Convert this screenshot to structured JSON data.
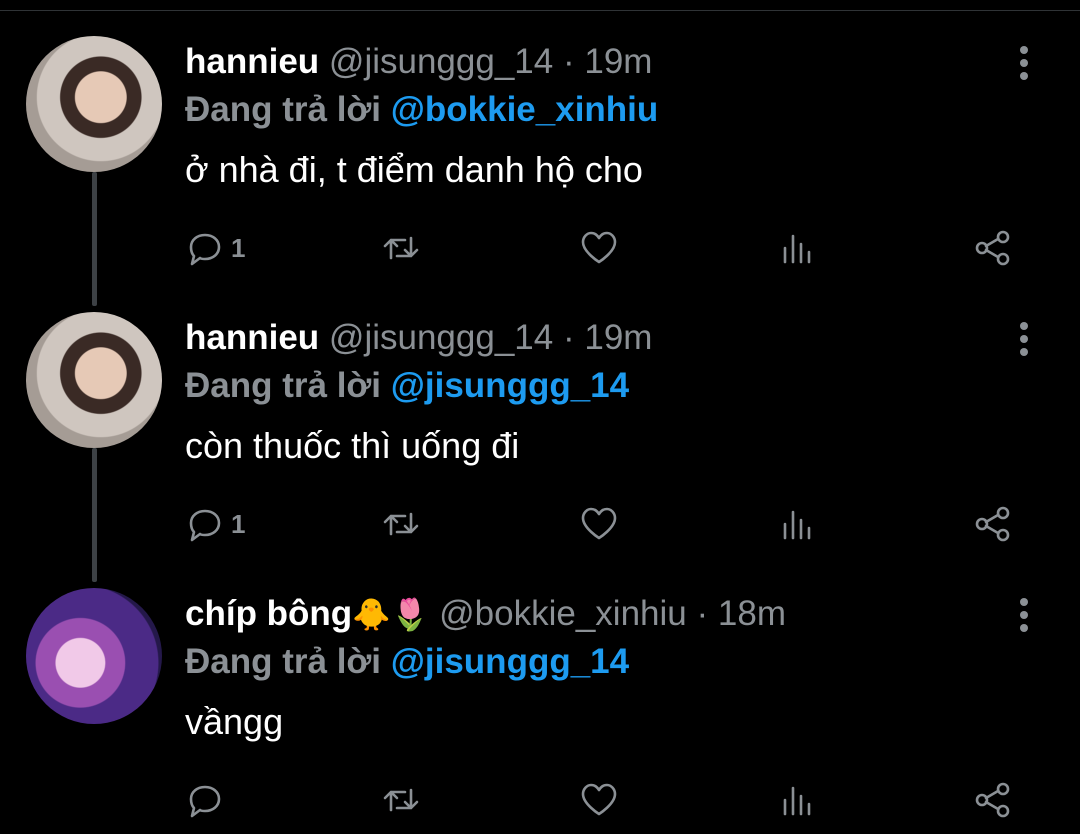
{
  "colors": {
    "background": "#000000",
    "accent": "#1d9bf0",
    "muted": "#8b9095",
    "text": "#ffffff"
  },
  "tweets": [
    {
      "name": "hannieu",
      "handle": "@jisunggg_14",
      "separator": "·",
      "time": "19m",
      "replying_prefix": "Đang trả lời",
      "replying_to": "@bokkie_xinhiu",
      "text": "ở nhà đi, t điểm danh hộ cho",
      "reply_count": "1",
      "avatar": "avatar-photo"
    },
    {
      "name": "hannieu",
      "handle": "@jisunggg_14",
      "separator": "·",
      "time": "19m",
      "replying_prefix": "Đang trả lời",
      "replying_to": "@jisunggg_14",
      "text": "còn thuốc thì uống đi",
      "reply_count": "1",
      "avatar": "avatar-photo"
    },
    {
      "name": "chíp bông",
      "name_emoji": "🐥🌷",
      "handle": "@bokkie_xinhiu",
      "separator": "·",
      "time": "18m",
      "replying_prefix": "Đang trả lời",
      "replying_to": "@jisunggg_14",
      "text": "vầngg",
      "reply_count": "",
      "avatar": "avatar-photo"
    }
  ],
  "icons": [
    "reply-icon",
    "retweet-icon",
    "like-icon",
    "views-icon",
    "share-icon",
    "more-icon"
  ]
}
